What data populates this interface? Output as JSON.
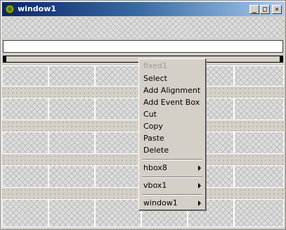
{
  "window": {
    "title": "window1"
  },
  "titlebar_buttons": [
    {
      "name": "minimize-button",
      "glyph": "_"
    },
    {
      "name": "maximize-button",
      "glyph": "□"
    },
    {
      "name": "close-button",
      "glyph": "✕"
    }
  ],
  "entry": {
    "value": ""
  },
  "context_menu": {
    "items": [
      {
        "label": "fixed1",
        "disabled": true
      },
      {
        "label": "Select"
      },
      {
        "label": "Add Alignment"
      },
      {
        "label": "Add Event Box"
      },
      {
        "label": "Cut"
      },
      {
        "label": "Copy"
      },
      {
        "label": "Paste"
      },
      {
        "label": "Delete"
      },
      {
        "label": "hbox8",
        "submenu": true
      },
      {
        "label": "vbox1",
        "submenu": true
      },
      {
        "label": "window1",
        "submenu": true
      }
    ]
  }
}
